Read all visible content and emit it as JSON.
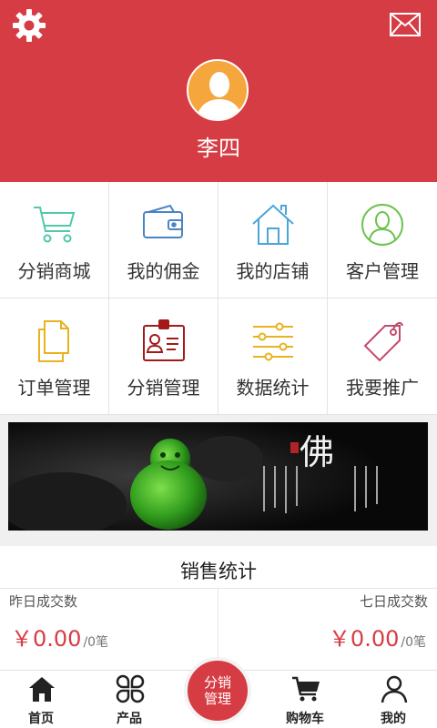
{
  "header": {
    "settings_icon": "gear-icon",
    "mail_icon": "mail-icon",
    "username": "李四"
  },
  "menu": [
    {
      "label": "分销商城",
      "icon": "cart-icon",
      "color": "#4fc9a9"
    },
    {
      "label": "我的佣金",
      "icon": "wallet-icon",
      "color": "#4a84c4"
    },
    {
      "label": "我的店铺",
      "icon": "home-icon",
      "color": "#4aa6d9"
    },
    {
      "label": "客户管理",
      "icon": "user-circle-icon",
      "color": "#6cc24a"
    },
    {
      "label": "订单管理",
      "icon": "document-icon",
      "color": "#e8b220"
    },
    {
      "label": "分销管理",
      "icon": "id-card-icon",
      "color": "#a31a1a"
    },
    {
      "label": "数据统计",
      "icon": "sliders-icon",
      "color": "#e8b220"
    },
    {
      "label": "我要推广",
      "icon": "tag-icon",
      "color": "#c34a6a"
    }
  ],
  "banner": {
    "title_char": "佛"
  },
  "stats": {
    "title": "销售统计",
    "left": {
      "label": "昨日成交数",
      "value": "￥0.00",
      "unit": "/0笔"
    },
    "right": {
      "label": "七日成交数",
      "value": "￥0.00",
      "unit": "/0笔"
    }
  },
  "tabbar": {
    "home": "首页",
    "products": "产品",
    "center": "分销管理",
    "cart": "购物车",
    "mine": "我的"
  },
  "colors": {
    "brand": "#d63c44"
  }
}
